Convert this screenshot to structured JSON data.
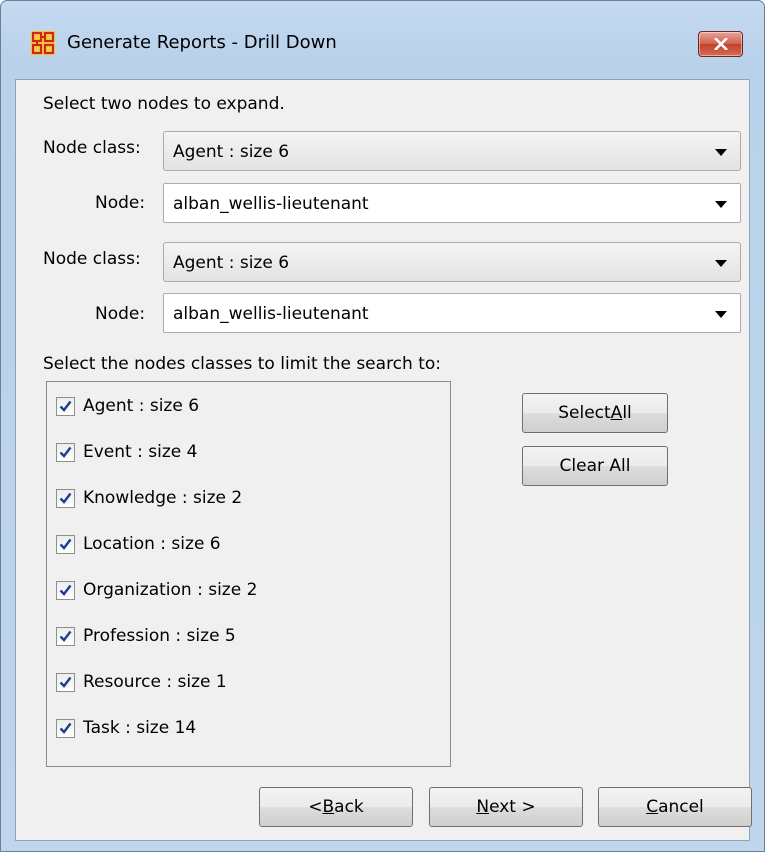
{
  "window": {
    "title": "Generate Reports - Drill Down"
  },
  "instructions": "Select two nodes to expand.",
  "node_class_label": "Node class:",
  "node_label": "Node:",
  "pair1": {
    "node_class": "Agent : size 6",
    "node": "alban_wellis-lieutenant"
  },
  "pair2": {
    "node_class": "Agent : size 6",
    "node": "alban_wellis-lieutenant"
  },
  "limit_label": "Select the nodes classes to limit the search to:",
  "node_classes": [
    {
      "label": "Agent : size 6",
      "checked": true
    },
    {
      "label": "Event : size 4",
      "checked": true
    },
    {
      "label": "Knowledge : size 2",
      "checked": true
    },
    {
      "label": "Location : size 6",
      "checked": true
    },
    {
      "label": "Organization : size 2",
      "checked": true
    },
    {
      "label": "Profession : size 5",
      "checked": true
    },
    {
      "label": "Resource : size 1",
      "checked": true
    },
    {
      "label": "Task : size 14",
      "checked": true
    }
  ],
  "buttons": {
    "select_all": {
      "pre": "Select ",
      "mnemonic": "A",
      "post": "ll"
    },
    "clear_all": "Clear All",
    "back": {
      "pre": "< ",
      "mnemonic": "B",
      "post": "ack"
    },
    "next": {
      "pre": "",
      "mnemonic": "N",
      "post": "ext >"
    },
    "cancel": {
      "pre": "",
      "mnemonic": "C",
      "post": "ancel"
    }
  },
  "colors": {
    "titlebar": "#b9d1ea",
    "client": "#f0f0f0",
    "close": "#c1432e",
    "checkmark": "#1c3f94"
  }
}
